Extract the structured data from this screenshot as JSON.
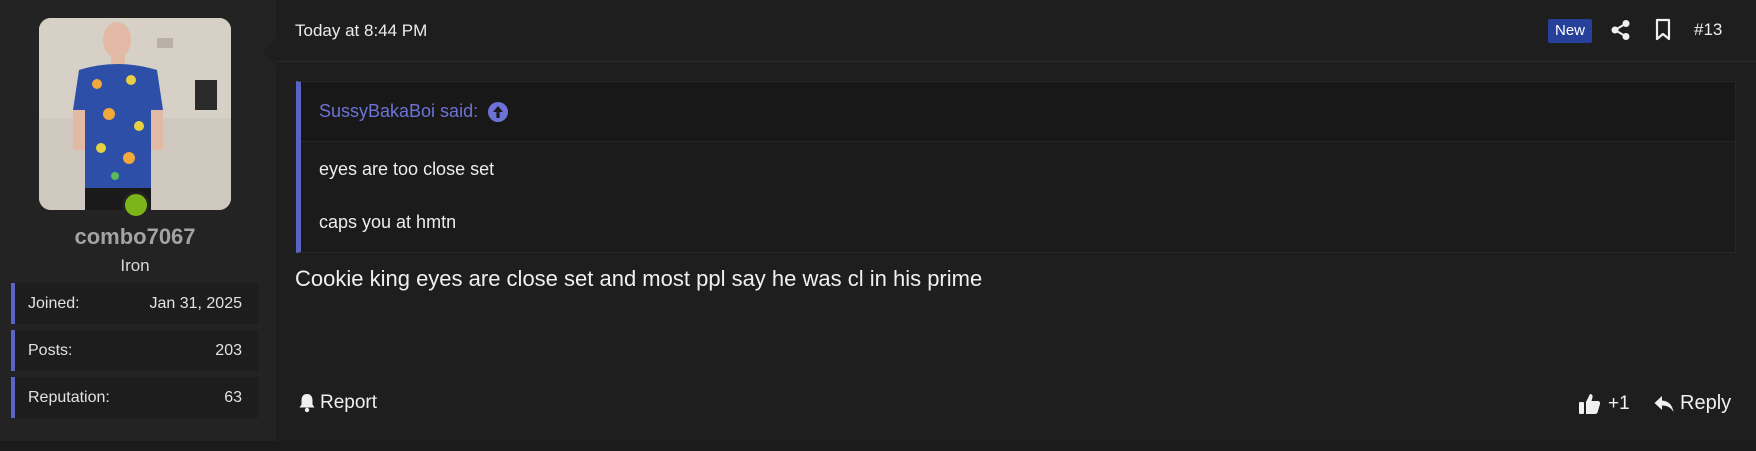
{
  "user": {
    "username": "combo7067",
    "title": "Iron",
    "online": true,
    "stats": [
      {
        "label": "Joined:",
        "value": "Jan 31, 2025"
      },
      {
        "label": "Posts:",
        "value": "203"
      },
      {
        "label": "Reputation:",
        "value": "63"
      }
    ]
  },
  "post": {
    "timestamp": "Today at 8:44 PM",
    "badge": "New",
    "number": "#13",
    "quote": {
      "author": "SussyBakaBoi said:",
      "lines": [
        "eyes are too close set",
        "caps you at hmtn"
      ]
    },
    "message": "Cookie king eyes are close set and most ppl say he was cl in his prime"
  },
  "actions": {
    "report": "Report",
    "like": "+1",
    "reply": "Reply"
  },
  "colors": {
    "accent": "#5b63c4",
    "online": "#7cb518",
    "badge": "#27409a"
  }
}
